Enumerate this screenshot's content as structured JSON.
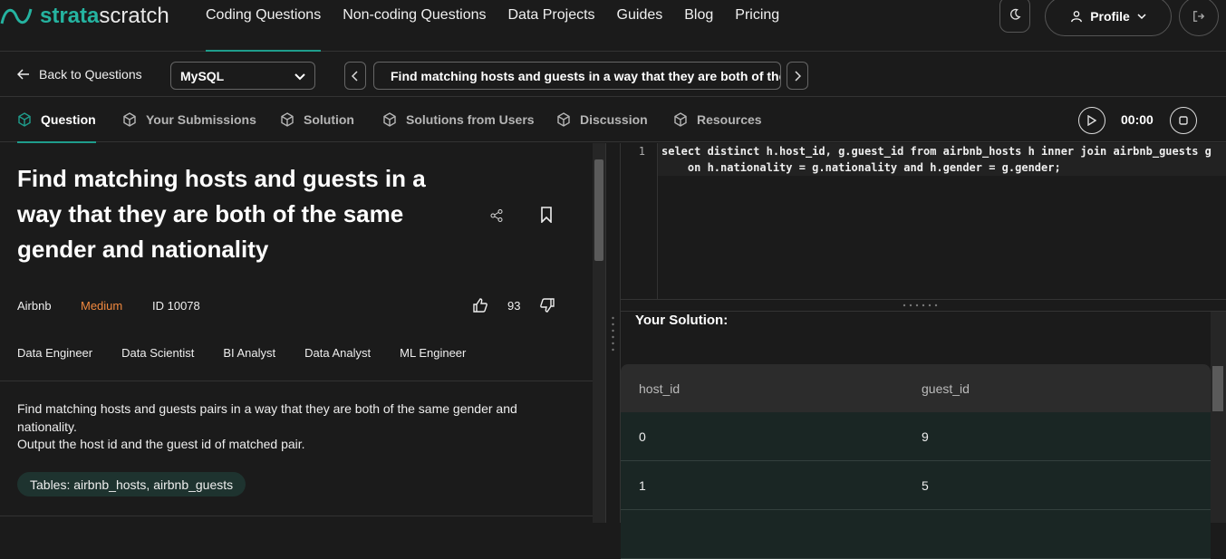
{
  "brand": {
    "part1": "strata",
    "part2": "scratch"
  },
  "nav": {
    "links": [
      "Coding Questions",
      "Non-coding Questions",
      "Data Projects",
      "Guides",
      "Blog",
      "Pricing"
    ],
    "profile_label": "Profile"
  },
  "toolbar": {
    "back_label": "Back to Questions",
    "dialect": "MySQL",
    "question_title_short": "Find matching hosts and guests in a way that they are both of the s"
  },
  "tabs": [
    "Question",
    "Your Submissions",
    "Solution",
    "Solutions from Users",
    "Discussion",
    "Resources"
  ],
  "timer": "00:00",
  "question": {
    "title": "Find matching hosts and guests in a way that they are both of the same gender and nationality",
    "company": "Airbnb",
    "difficulty": "Medium",
    "id_label": "ID 10078",
    "likes": "93",
    "roles": [
      "Data Engineer",
      "Data Scientist",
      "BI Analyst",
      "Data Analyst",
      "ML Engineer"
    ],
    "description_line1": "Find matching hosts and guests pairs in a way that they are both of the same gender and nationality.",
    "description_line2": "Output the host id and the guest id of matched pair.",
    "tables_label": "Tables: airbnb_hosts, airbnb_guests"
  },
  "editor": {
    "line_number": "1",
    "line1": "select distinct h.host_id, g.guest_id from airbnb_hosts h inner join airbnb_guests g",
    "line2": "    on h.nationality = g.nationality and h.gender = g.gender;"
  },
  "result": {
    "heading": "Your Solution:",
    "columns": [
      "host_id",
      "guest_id"
    ],
    "rows": [
      [
        "0",
        "9"
      ],
      [
        "1",
        "5"
      ]
    ]
  },
  "colors": {
    "accent": "#1f9d8c",
    "difficulty_medium": "#f0883e",
    "background": "#1b1b1b"
  }
}
